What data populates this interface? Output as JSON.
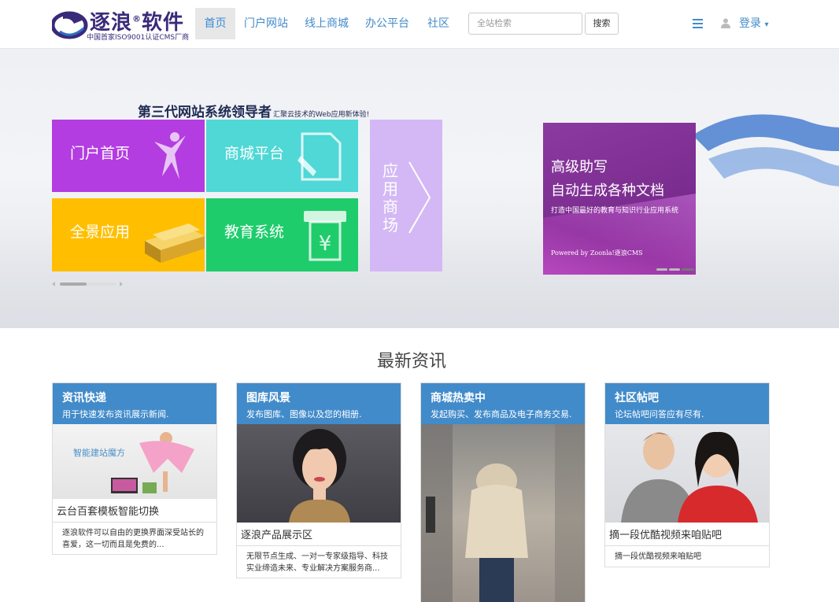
{
  "brand": {
    "name": "逐浪",
    "name_suffix": "软件",
    "registered": "®",
    "tagline": "中国首家ISO9001认证CMS厂商"
  },
  "nav": {
    "items": [
      {
        "label": "首页",
        "active": true
      },
      {
        "label": "门户网站",
        "active": false
      },
      {
        "label": "线上商城",
        "active": false
      },
      {
        "label": "办公平台",
        "active": false
      },
      {
        "label": "社区",
        "active": false
      }
    ],
    "search_placeholder": "全站检索",
    "search_button": "搜索",
    "menu_icon": "hamburger-icon",
    "user_icon": "user-icon",
    "login_label": "登录",
    "login_caret": "▾"
  },
  "banner": {
    "headline": "第三代网站系统领导者",
    "headline_sub": "汇聚云技术的Web应用新体验!",
    "tiles": [
      {
        "label": "门户首页",
        "icon": "dancer-icon",
        "color": "#b33de0"
      },
      {
        "label": "商城平台",
        "icon": "document-pencil-icon",
        "color": "#4fd8d5"
      },
      {
        "label": "全景应用",
        "icon": "gold-bars-icon",
        "color": "#ffbf00"
      },
      {
        "label": "教育系统",
        "icon": "atm-yuan-icon",
        "color": "#1fcc6b"
      },
      {
        "label": "应用商场",
        "icon": "chevron-right-icon",
        "color": "#d4b8f5"
      }
    ],
    "ad": {
      "line1": "高级助写",
      "line2": "自动生成各种文档",
      "line3": "打造中国最好的教育与知识行业应用系统",
      "line4": "Powered by Zoonla!逐浪CMS"
    }
  },
  "news": {
    "title": "最新资讯",
    "cards": [
      {
        "heading": "资讯快递",
        "subheading": "用于快速发布资讯展示新闻.",
        "image_caption_overlay": "智能建站魔方",
        "caption": "云台百套模板智能切换",
        "text": "逐浪软件可以自由的更换界面深受站长的喜爱，这一切而且是免费的..."
      },
      {
        "heading": "图库风景",
        "subheading": "发布图库、图像以及您的相册.",
        "caption": "逐浪产品展示区",
        "text": "无限节点生成、一对一专家级指导、科技实业缔造未来、专业解决方案服务商..."
      },
      {
        "heading": "商城热卖中",
        "subheading": "发起购买、发布商品及电子商务交易.",
        "caption": "",
        "text": ""
      },
      {
        "heading": "社区帖吧",
        "subheading": "论坛帖吧问答应有尽有.",
        "caption": "摘一段优酷视频来咱贴吧",
        "text": "摘一段优酷视频来咱贴吧"
      }
    ]
  },
  "colors": {
    "primary": "#428bca",
    "brand": "#3a2a7a"
  }
}
